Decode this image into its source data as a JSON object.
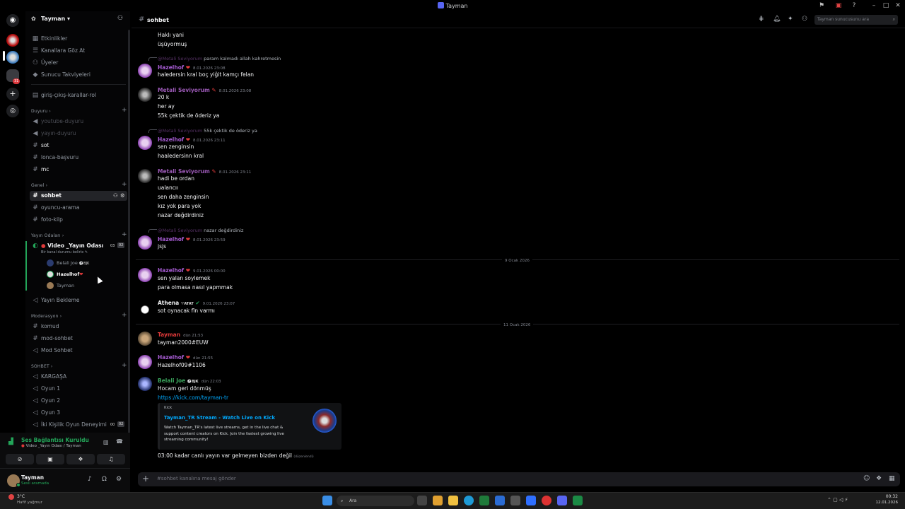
{
  "window": {
    "title": "Tayman"
  },
  "server": {
    "name": "Tayman",
    "chevron": "▾"
  },
  "rail": {
    "notification_count": "31"
  },
  "sidebar": {
    "top_items": [
      "Etkinlikler",
      "Kanallara Göz At",
      "Üyeler",
      "Sunucu Takviyeleri"
    ],
    "pinned_channel": "giriş-çıkış-karallar-rol",
    "cat_duyuru": "Duyuru",
    "duyuru_channels": [
      "youtube-duyuru",
      "yayın-duyuru",
      "sot",
      "lonca-başvuru",
      "mc"
    ],
    "cat_genel": "Genel",
    "genel_channels": [
      "sohbet",
      "oyuncu-arama",
      "foto-kilp"
    ],
    "cat_yayin": "Yayın Odaları",
    "voice_room": {
      "name": "Video _Yayın Odası",
      "status": "Bir kanal durumu belirle",
      "count_a": "03",
      "count_b": "02"
    },
    "voice_users": [
      {
        "name": "Belali Joe",
        "tag": "BJK"
      },
      {
        "name": "Hazelhof",
        "tag": "❤"
      },
      {
        "name": "Tayman",
        "tag": ""
      }
    ],
    "yayin_bekleme": "Yayın Bekleme",
    "cat_mod": "Moderasyon",
    "mod_channels": [
      "komud",
      "mod-sohbet",
      "Mod Sohbet"
    ],
    "cat_sohbet": "SOHBET",
    "sohbet_voice": [
      "KARGAŞA",
      "Oyun 1",
      "Oyun 2",
      "Oyun 3",
      "İki Kişilik Oyun Deneyimi"
    ],
    "iki_kisi_counts": [
      "00",
      "02"
    ]
  },
  "voice_panel": {
    "status": "Ses Bağlantısı Kuruldu",
    "channel": "Video _Yayın Odası / Tayman"
  },
  "user_panel": {
    "name": "Tayman",
    "status": "Sesli aramada"
  },
  "header": {
    "channel": "sohbet",
    "search_placeholder": "Tayman sunucusunu ara"
  },
  "messages": {
    "top_lines": [
      "Haklı yani",
      "üşüyormuş"
    ],
    "r1_name": "@Metali Seviyorum",
    "r1_text": "param kalmadı allah kahretmesin",
    "m1": {
      "user": "Hazelhof",
      "time": "8.01.2026 23:08",
      "text": "haledersin kral boç yiğit kamçı felan"
    },
    "m2": {
      "user": "Metali Seviyorum",
      "time": "8.01.2026 23:08",
      "lines": [
        "20 k",
        "her ay",
        "55k çektik de öderiz ya"
      ]
    },
    "r2_name": "@Metali Seviyorum",
    "r2_text": "55k çektik de öderiz ya",
    "m3": {
      "user": "Hazelhof",
      "time": "8.01.2026 23:11",
      "lines": [
        "sen zenginsin",
        "haaledersinn kral"
      ]
    },
    "m4": {
      "user": "Metali Seviyorum",
      "time": "8.01.2026 23:11",
      "lines": [
        "hadi be ordan",
        "ualancıı",
        "sen daha zenginsin",
        "kız yok para yok",
        "nazar değdirdiniz"
      ]
    },
    "r3_name": "@Metali Seviyorum",
    "r3_text": "nazar değdirdiniz",
    "m5": {
      "user": "Hazelhof",
      "time": "8.01.2026 23:59",
      "text": "jsjs"
    },
    "date1": "9 Ocak 2026",
    "m6": {
      "user": "Hazelhof",
      "time": "9.01.2026 00:00",
      "lines": [
        "sen yalan soylemek",
        "para olmasa nasıl yapmmak"
      ]
    },
    "m7": {
      "user": "Athena",
      "tag": "ATAT",
      "time": "9.01.2026 23:07",
      "text": "sot oynacak fln varmı"
    },
    "date2": "11 Ocak 2026",
    "m8": {
      "user": "Tayman",
      "time": "dün 21:53",
      "text": "tayman2000#EUW"
    },
    "m9": {
      "user": "Hazelhof",
      "time": "dün 21:55",
      "text": "Hazelhof09#1106"
    },
    "m10": {
      "user": "Belali Joe",
      "tag": "BJK",
      "time": "dün 22:03",
      "text": "Hocam geri dönmüş",
      "link": "https://kick.com/tayman-tr"
    },
    "embed": {
      "provider": "Kick",
      "title": "Tayman_TR Stream - Watch Live on Kick",
      "desc": "Watch Tayman_TR's latest live streams, get in the live chat & support content creators on Kick. Join the fastest growing live streaming community!"
    },
    "last_line": "03:00 kadar canlı yayın var gelmeyen  bizden değil",
    "edited": "(düzenlendi)"
  },
  "input": {
    "placeholder": "#sohbet kanalına mesaj gönder"
  },
  "taskbar": {
    "temp": "3°C",
    "weather": "Hafif yağmur",
    "search": "Ara",
    "time": "00:32",
    "date": "12.01.2026"
  },
  "colors": {
    "hazel": "#a55bd1",
    "metali": "#9b59b6",
    "belali": "#3ba55d",
    "tayman": "#e03a3a"
  }
}
